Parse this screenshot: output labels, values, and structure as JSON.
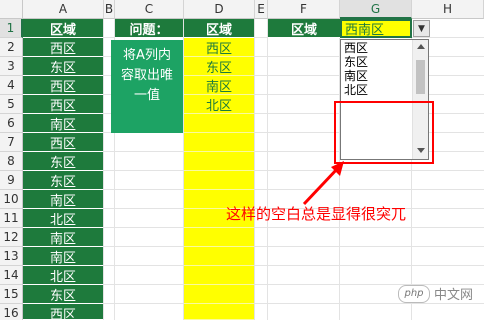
{
  "columns": [
    "A",
    "B",
    "C",
    "D",
    "E",
    "F",
    "G",
    "H"
  ],
  "rows": [
    "1",
    "2",
    "3",
    "4",
    "5",
    "6",
    "7",
    "8",
    "9",
    "10",
    "11",
    "12",
    "13",
    "14",
    "15",
    "16"
  ],
  "selected_column": "G",
  "selected_row": "1",
  "col_a": [
    "区域",
    "西区",
    "东区",
    "西区",
    "西区",
    "南区",
    "西区",
    "东区",
    "东区",
    "南区",
    "北区",
    "南区",
    "南区",
    "北区",
    "东区",
    "西区"
  ],
  "col_c_header": "问题：",
  "col_c_note": [
    "将A列内",
    "容取出唯",
    "一值"
  ],
  "col_d": [
    "区域",
    "西区",
    "东区",
    "南区",
    "北区"
  ],
  "f1": "区域",
  "g1": "西南区",
  "dropdown": {
    "options": [
      "西区",
      "东区",
      "南区",
      "北区"
    ]
  },
  "annotation": "这样的空白总是显得很突兀",
  "watermark": {
    "logo": "php",
    "text": "中文网"
  },
  "colors": {
    "green": "#1e7a3c",
    "teal": "#1da364",
    "yellow": "#ffff00",
    "red": "#ff0000"
  }
}
